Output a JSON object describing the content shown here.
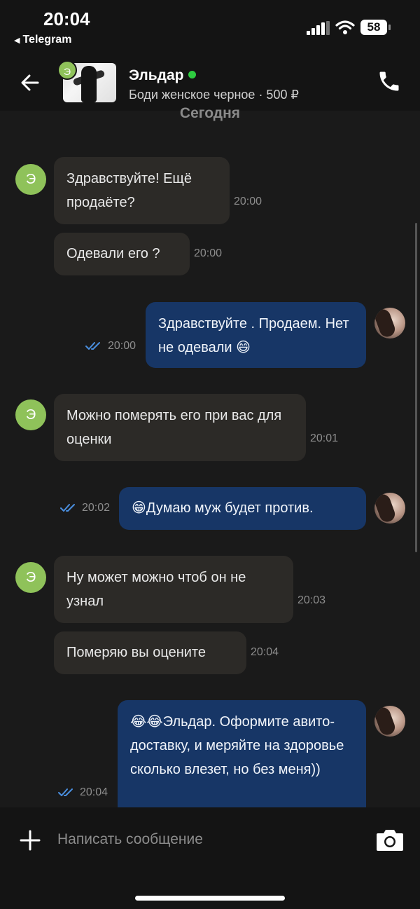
{
  "status": {
    "time": "20:04",
    "back_app": "Telegram",
    "battery": "58"
  },
  "header": {
    "name": "Эльдар",
    "subtitle": "Боди женское черное · 500 ₽",
    "avatar_letter": "Э"
  },
  "date_label": "Сегодня",
  "messages": [
    {
      "side": "in",
      "text": "Здравствуйте! Ещё продаёте?",
      "time": "20:00"
    },
    {
      "side": "in",
      "text": "Одевали его ?",
      "time": "20:00"
    },
    {
      "side": "out",
      "text": "Здравствуйте . Продаем. Нет не одевали 😄",
      "time": "20:00"
    },
    {
      "side": "in",
      "text": "Можно померять его при вас для оценки",
      "time": "20:01"
    },
    {
      "side": "out",
      "text": "😁Думаю муж будет против.",
      "time": "20:02"
    },
    {
      "side": "in",
      "text": "Ну может можно чтоб он не узнал",
      "time": "20:03"
    },
    {
      "side": "in",
      "text": "Померяю вы оцените",
      "time": "20:04"
    },
    {
      "side": "out",
      "text": "😂😂Эльдар. Оформите авито-доставку, и меряйте на здоровье сколько влезет, но без меня))",
      "time": "20:04"
    }
  ],
  "composer": {
    "placeholder": "Написать сообщение"
  },
  "colors": {
    "incoming": "#2c2a27",
    "outgoing": "#173666",
    "avatar": "#8fc25a",
    "online": "#2ecc40",
    "ticks": "#4a8fe0"
  }
}
